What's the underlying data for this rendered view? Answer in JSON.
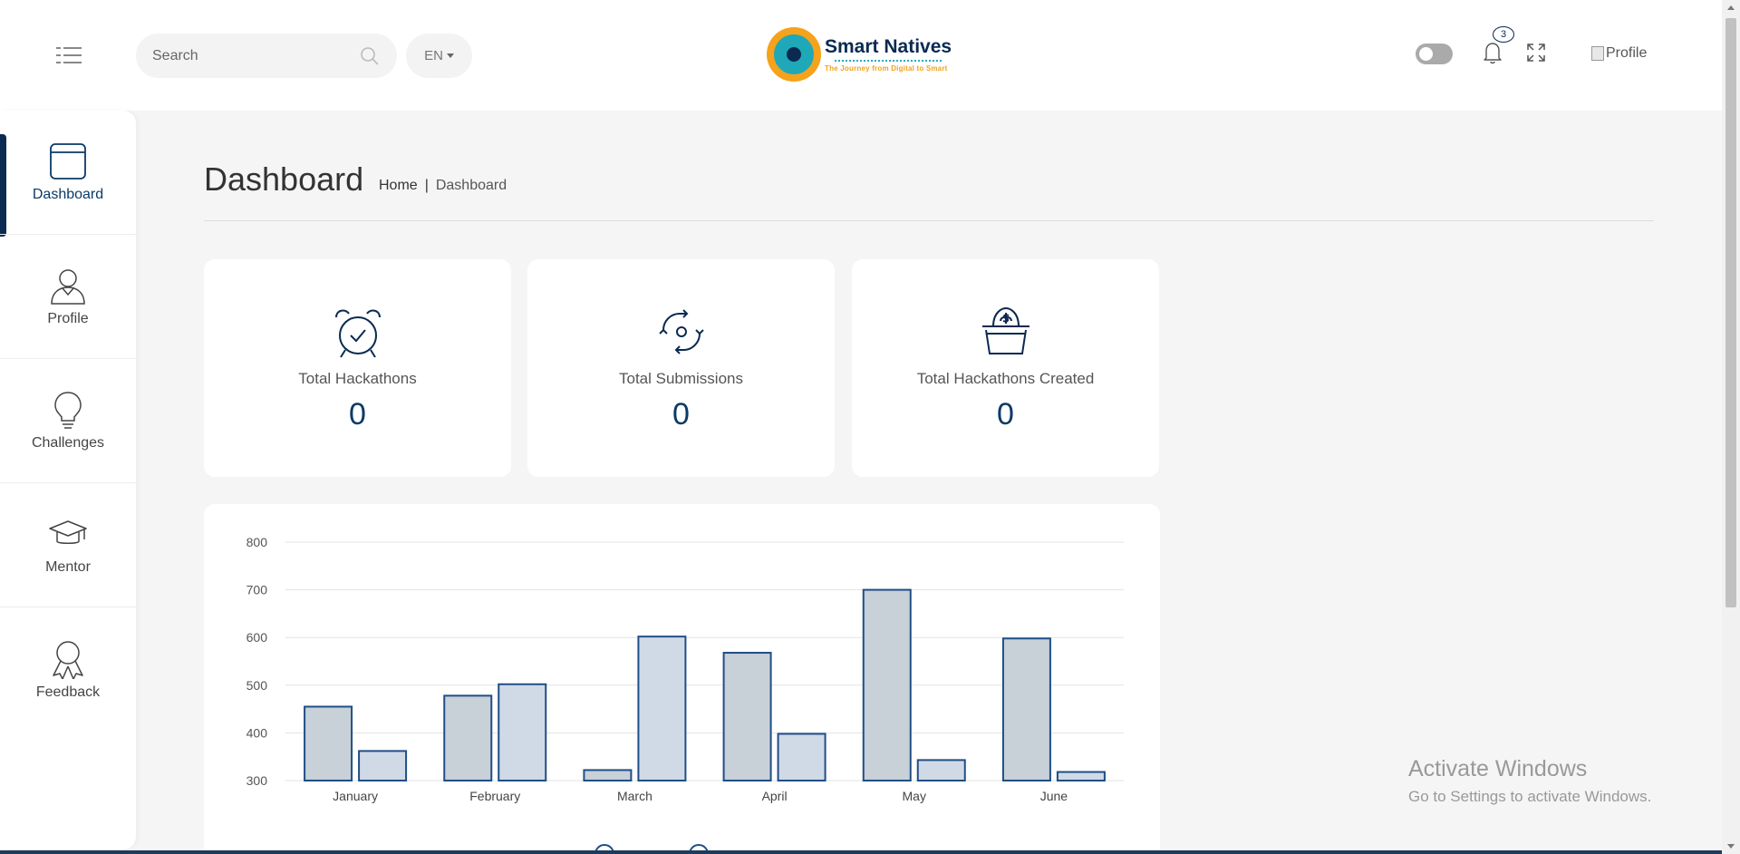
{
  "header": {
    "search_placeholder": "Search",
    "language": "EN",
    "logo_name": "Smart Natives",
    "logo_tagline": "The Journey from Digital to Smart",
    "notification_count": "3",
    "profile_alt": "Profile"
  },
  "sidebar": {
    "items": [
      {
        "label": "Dashboard",
        "icon": "dashboard-icon",
        "active": true
      },
      {
        "label": "Profile",
        "icon": "user-icon"
      },
      {
        "label": "Challenges",
        "icon": "lightbulb-icon"
      },
      {
        "label": "Mentor",
        "icon": "graduation-cap-icon"
      },
      {
        "label": "Feedback",
        "icon": "award-ribbon-icon"
      }
    ]
  },
  "page": {
    "title": "Dashboard",
    "breadcrumb": {
      "home": "Home",
      "separator": "|",
      "current": "Dashboard"
    }
  },
  "stats": [
    {
      "label": "Total Hackathons",
      "value": "0",
      "icon": "alarm-clock-icon"
    },
    {
      "label": "Total Submissions",
      "value": "0",
      "icon": "refresh-cycle-icon"
    },
    {
      "label": "Total Hackathons Created",
      "value": "0",
      "icon": "money-basket-icon"
    }
  ],
  "chart_data": {
    "type": "bar",
    "categories": [
      "January",
      "February",
      "March",
      "April",
      "May",
      "June"
    ],
    "series": [
      {
        "values": [
          455,
          478,
          322,
          568,
          700,
          598
        ],
        "color": "#c8d0d8"
      },
      {
        "values": [
          362,
          502,
          602,
          398,
          343,
          318
        ],
        "color": "#d0dae6"
      }
    ],
    "ylim": [
      300,
      800
    ],
    "yticks": [
      300,
      400,
      500,
      600,
      700,
      800
    ],
    "grid": true
  },
  "watermark": {
    "line1": "Activate Windows",
    "line2": "Go to Settings to activate Windows."
  },
  "colors": {
    "accent": "#0b2a52",
    "logo_orange": "#f5a21c",
    "logo_teal": "#1ea8b8",
    "bar_border": "#1f4e86"
  }
}
